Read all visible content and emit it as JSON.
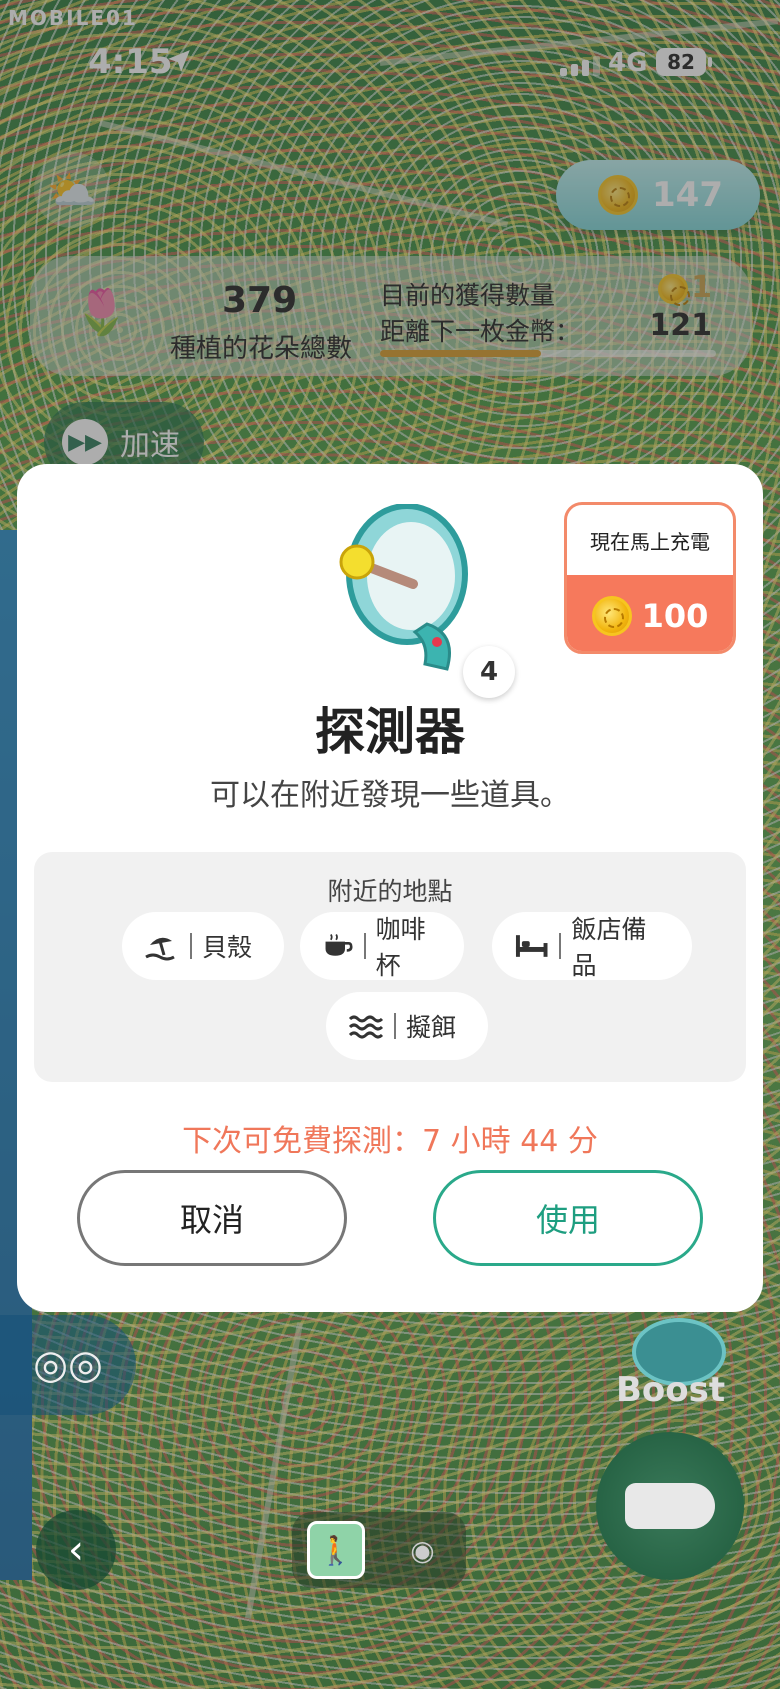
{
  "status_bar": {
    "watermark": "MOBILE01",
    "time": "4:15",
    "network": "4G",
    "battery": "82"
  },
  "hud": {
    "coins": "147",
    "planted_total": "379",
    "planted_total_label": "種植的花朵總數",
    "current_earned_label": "目前的獲得數量",
    "current_earned_value": "1",
    "next_coin_label": "距離下一枚金幣：",
    "next_coin_value": "121",
    "next_coin_progress": 0.48,
    "speed_label": "加速"
  },
  "modal": {
    "recharge_label": "現在馬上充電",
    "recharge_cost": "100",
    "item_count": "4",
    "item_name": "探測器",
    "item_desc": "可以在附近發現一些道具。",
    "nearby_title": "附近的地點",
    "places": [
      {
        "label": "貝殼",
        "icon": "beach-icon"
      },
      {
        "label": "咖啡杯",
        "icon": "coffee-cup-icon"
      },
      {
        "label": "飯店備品",
        "icon": "bed-icon"
      },
      {
        "label": "擬餌",
        "icon": "waves-icon"
      }
    ],
    "next_free": "下次可免費探測：7 小時 44 分",
    "cancel_label": "取消",
    "use_label": "使用"
  },
  "bottom": {
    "boost_label": "Boost"
  },
  "colors": {
    "accent_orange": "#f6795c",
    "accent_teal": "#2aa98a",
    "next_free": "#f0775a"
  }
}
